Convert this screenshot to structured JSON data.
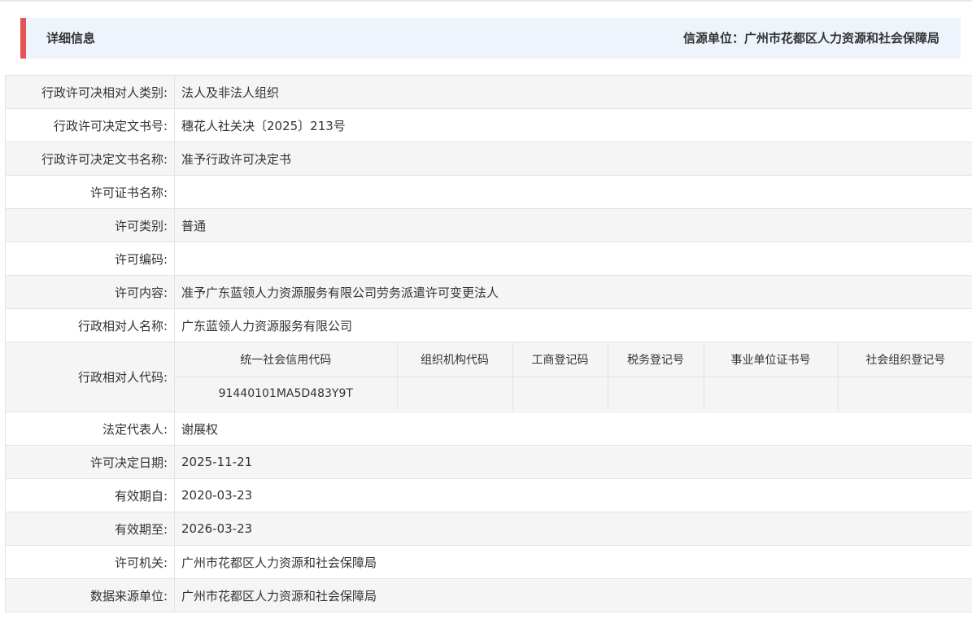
{
  "header": {
    "title": "详细信息",
    "source_label": "信源单位：广州市花都区人力资源和社会保障局"
  },
  "colors": {
    "accent": "#e45454",
    "header_bg": "#eef4fb",
    "row_shade": "#f5f5f5",
    "border": "#e3e3e3"
  },
  "rows": {
    "party_type": {
      "label": "行政许可决相对人类别:",
      "value": "法人及非法人组织"
    },
    "doc_number": {
      "label": "行政许可决定文书号:",
      "value": "穗花人社关决〔2025〕213号"
    },
    "doc_name": {
      "label": "行政许可决定文书名称:",
      "value": "准予行政许可决定书"
    },
    "cert_name": {
      "label": "许可证书名称:",
      "value": ""
    },
    "category": {
      "label": "许可类别:",
      "value": "普通"
    },
    "code": {
      "label": "许可编码:",
      "value": ""
    },
    "content": {
      "label": "许可内容:",
      "value": "准予广东蓝领人力资源服务有限公司劳务派遣许可变更法人"
    },
    "party_name": {
      "label": "行政相对人名称:",
      "value": "广东蓝领人力资源服务有限公司"
    },
    "party_code": {
      "label": "行政相对人代码:",
      "columns": [
        "统一社会信用代码",
        "组织机构代码",
        "工商登记码",
        "税务登记号",
        "事业单位证书号",
        "社会组织登记号"
      ],
      "values": [
        "91440101MA5D483Y9T",
        "",
        "",
        "",
        "",
        ""
      ]
    },
    "legal_rep": {
      "label": "法定代表人:",
      "value": "谢展权"
    },
    "decision_date": {
      "label": "许可决定日期:",
      "value": "2025-11-21"
    },
    "valid_from": {
      "label": "有效期自:",
      "value": "2020-03-23"
    },
    "valid_to": {
      "label": "有效期至:",
      "value": "2026-03-23"
    },
    "authority": {
      "label": "许可机关:",
      "value": "广州市花都区人力资源和社会保障局"
    },
    "data_source": {
      "label": "数据来源单位:",
      "value": "广州市花都区人力资源和社会保障局"
    }
  }
}
